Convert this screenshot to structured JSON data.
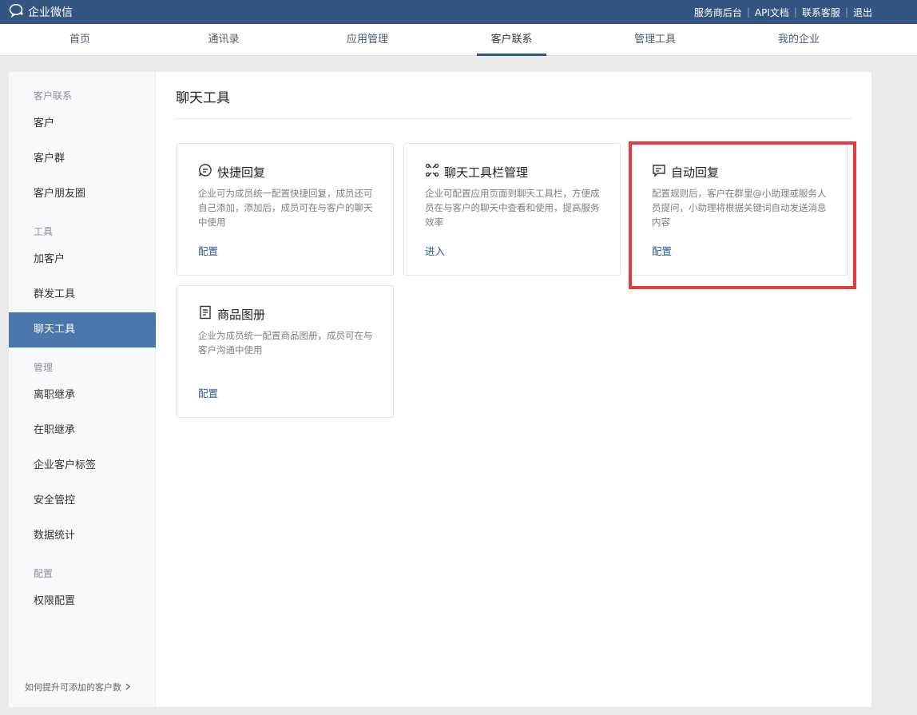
{
  "app": {
    "logo_text": "企业微信"
  },
  "toplinks": [
    "服务商后台",
    "API文档",
    "联系客服",
    "退出"
  ],
  "nav": {
    "items": [
      "首页",
      "通讯录",
      "应用管理",
      "客户联系",
      "管理工具",
      "我的企业"
    ],
    "active": "客户联系"
  },
  "sidebar": {
    "groups": {
      "customer": "客户联系",
      "tools": "工具",
      "manage": "管理",
      "config": "配置"
    },
    "items": {
      "customer": "客户",
      "customer_group": "客户群",
      "moments": "客户朋友圈",
      "add_customer": "加客户",
      "mass_send": "群发工具",
      "chat_tools": "聊天工具",
      "resign_inherit": "离职继承",
      "onjob_inherit": "在职继承",
      "tags": "企业客户标签",
      "security": "安全管控",
      "stats": "数据统计",
      "permission": "权限配置"
    },
    "active": "聊天工具",
    "footer": "如何提升可添加的客户数"
  },
  "main": {
    "title": "聊天工具",
    "cards": [
      {
        "icon": "chat-bubble-icon",
        "title": "快捷回复",
        "desc": "企业可为成员统一配置快捷回复，成员还可自己添加，添加后，成员可在与客户的聊天中使用",
        "link": "配置"
      },
      {
        "icon": "toolbar-grid-icon",
        "title": "聊天工具栏管理",
        "desc": "企业可配置应用页面到聊天工具栏，方便成员在与客户的聊天中查看和使用，提高服务效率",
        "link": "进入"
      },
      {
        "icon": "auto-reply-icon",
        "title": "自动回复",
        "desc": "配置规则后，客户在群里@小助理或服务人员提问，小助理将根据关键词自动发送消息内容",
        "link": "配置"
      },
      {
        "icon": "catalog-icon",
        "title": "商品图册",
        "desc": "企业为成员统一配置商品图册，成员可在与客户沟通中使用",
        "link": "配置"
      }
    ]
  },
  "colors": {
    "topbar": "#325681",
    "accent": "#4b76ab",
    "link": "#2d5b8f",
    "highlight": "#e8393c"
  }
}
